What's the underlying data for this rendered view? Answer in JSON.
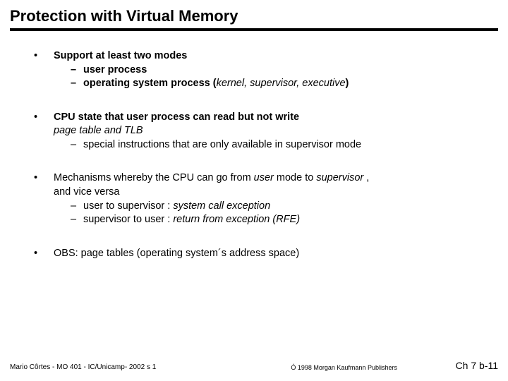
{
  "title": "Protection with Virtual Memory",
  "b1": {
    "line1": "Support at least two modes",
    "s1": "user process",
    "s2a": "operating system process (",
    "s2b": "kernel, supervisor, executive",
    "s2c": ")"
  },
  "b2": {
    "line1": "CPU state that user process can read but not write",
    "line2": "page table and TLB",
    "s1": "special instructions that are only available in supervisor mode"
  },
  "b3": {
    "line1a": "Mechanisms whereby the CPU can go from ",
    "line1b": "user",
    "line1c": " mode to ",
    "line1d": "supervisor",
    "line1e": " ,",
    "line2": "and vice versa",
    "s1a": "user to supervisor : ",
    "s1b": "system call exception",
    "s2a": "supervisor to user :  ",
    "s2b": "return from exception (RFE)"
  },
  "b4": {
    "line1": "OBS: page tables (operating system´s address space)"
  },
  "footer": {
    "left": "Mario Côrtes - MO 401 - IC/Unicamp- 2002 s 1",
    "center": "Ó 1998 Morgan Kaufmann Publishers",
    "right": "Ch 7 b-11"
  },
  "glyph": {
    "bullet": "•",
    "dash": "–"
  }
}
